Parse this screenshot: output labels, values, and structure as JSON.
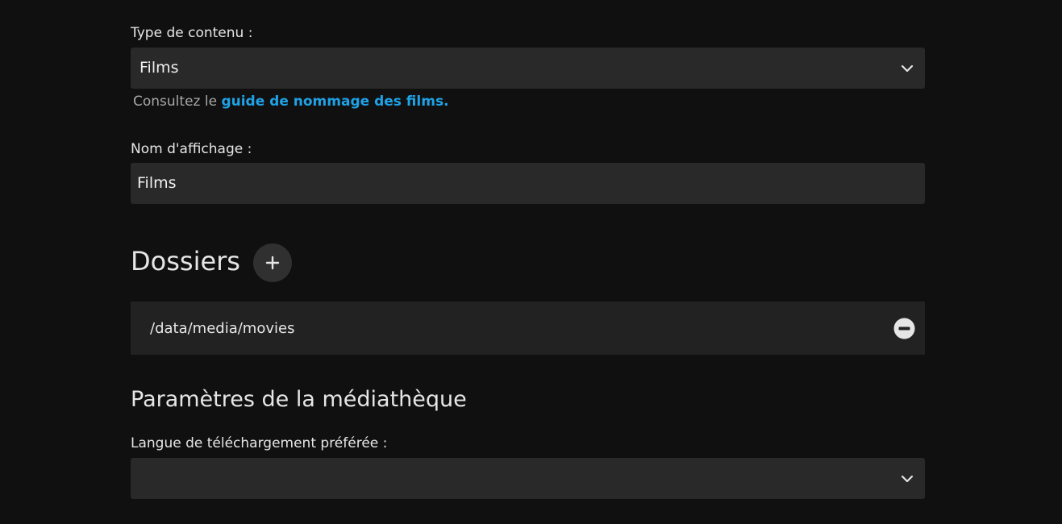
{
  "content_type": {
    "label": "Type de contenu :",
    "selected": "Films",
    "hint_prefix": "Consultez le ",
    "hint_link": "guide de nommage des films",
    "hint_suffix": "."
  },
  "display_name": {
    "label": "Nom d'affichage :",
    "value": "Films"
  },
  "folders": {
    "title": "Dossiers",
    "add_symbol": "+",
    "items": [
      {
        "path": "/data/media/movies"
      }
    ]
  },
  "library_settings": {
    "title": "Paramètres de la médiathèque",
    "preferred_language": {
      "label": "Langue de téléchargement préférée :",
      "selected": ""
    }
  },
  "icons": {
    "dropdown": "chevron-down-icon",
    "add": "plus-icon",
    "remove": "minus-circle-icon"
  },
  "colors": {
    "background": "#101010",
    "field": "#292929",
    "link": "#1fa2e6"
  }
}
